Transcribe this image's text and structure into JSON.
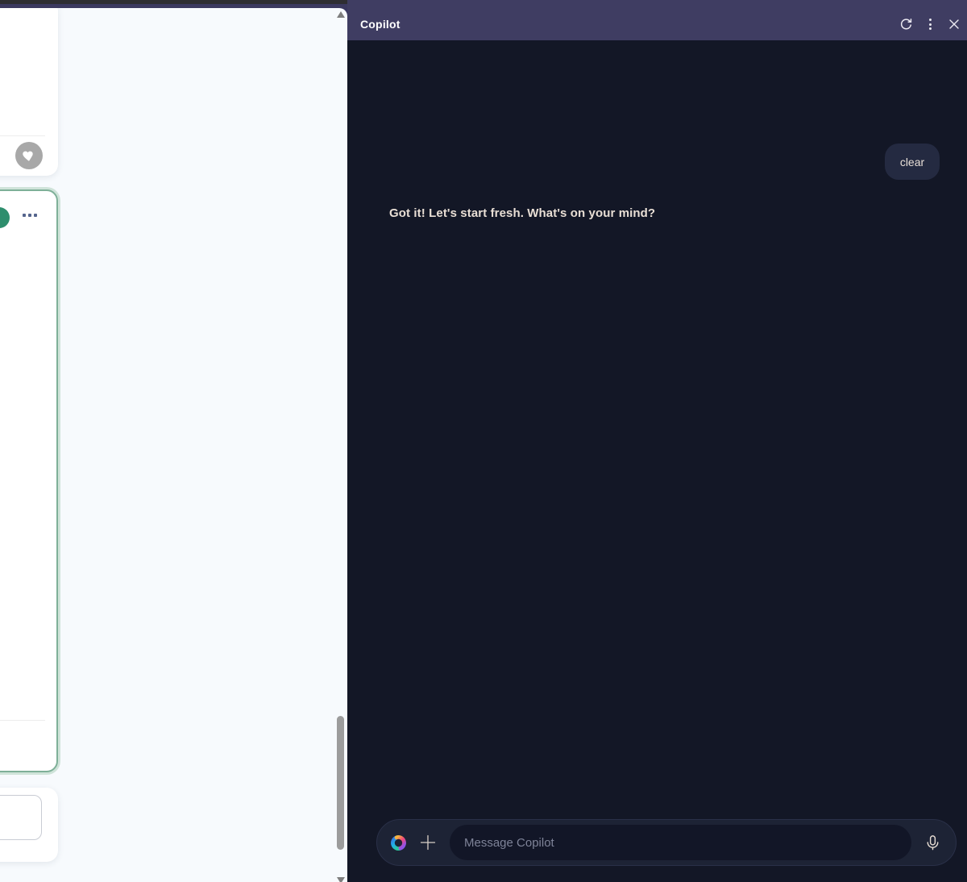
{
  "left_page": {
    "cards": {
      "favorite_icon": "heart-icon",
      "status_icon": "green-dot",
      "more_options_icon": "ellipsis-icon"
    },
    "scrollbar": {
      "up_icon": "scroll-up-arrow",
      "down_icon": "scroll-down-arrow"
    }
  },
  "copilot": {
    "header": {
      "title": "Copilot",
      "icons": [
        "refresh-icon",
        "kebab-menu-icon",
        "close-icon"
      ]
    },
    "conversation": {
      "user_message": "clear",
      "assistant_message": "Got it! Let's start fresh. What's on your mind?"
    },
    "composer": {
      "placeholder": "Message Copilot",
      "icons": [
        "copilot-logo",
        "plus-icon",
        "microphone-icon"
      ]
    },
    "colors": {
      "header_bg": "#3f3d62",
      "panel_bg": "#131726",
      "bubble_bg": "#242a41",
      "text_cream": "#e9dfd5",
      "composer_bg": "#1d2335",
      "field_bg": "#121627",
      "selected_card_border": "#7eb098"
    }
  }
}
